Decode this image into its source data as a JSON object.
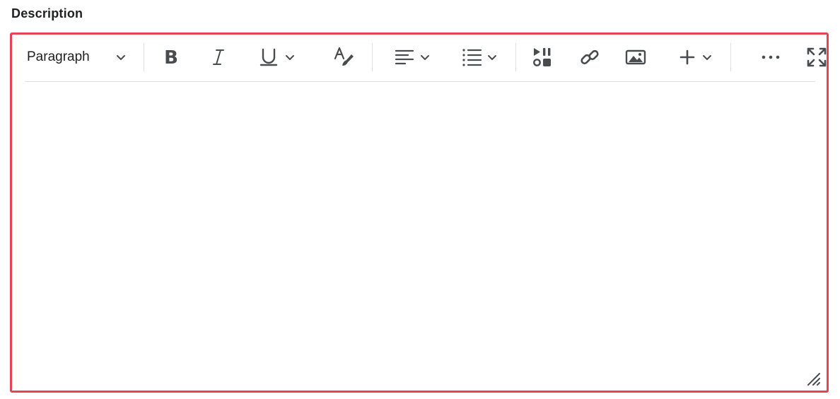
{
  "field": {
    "label": "Description"
  },
  "toolbar": {
    "format_value": "Paragraph",
    "icons": {
      "format_dropdown": "chevron-down-icon",
      "bold": "bold-icon",
      "italic": "italic-icon",
      "underline": "underline-icon",
      "format_painter": "text-style-icon",
      "align": "align-left-icon",
      "list": "bulleted-list-icon",
      "media": "insert-media-icon",
      "link": "link-icon",
      "image": "image-icon",
      "insert": "plus-icon",
      "more": "more-icon",
      "fullscreen": "fullscreen-icon"
    }
  },
  "colors": {
    "focus_border": "#e5454f",
    "icon": "#494c4e",
    "divider": "#dcdfe3"
  }
}
